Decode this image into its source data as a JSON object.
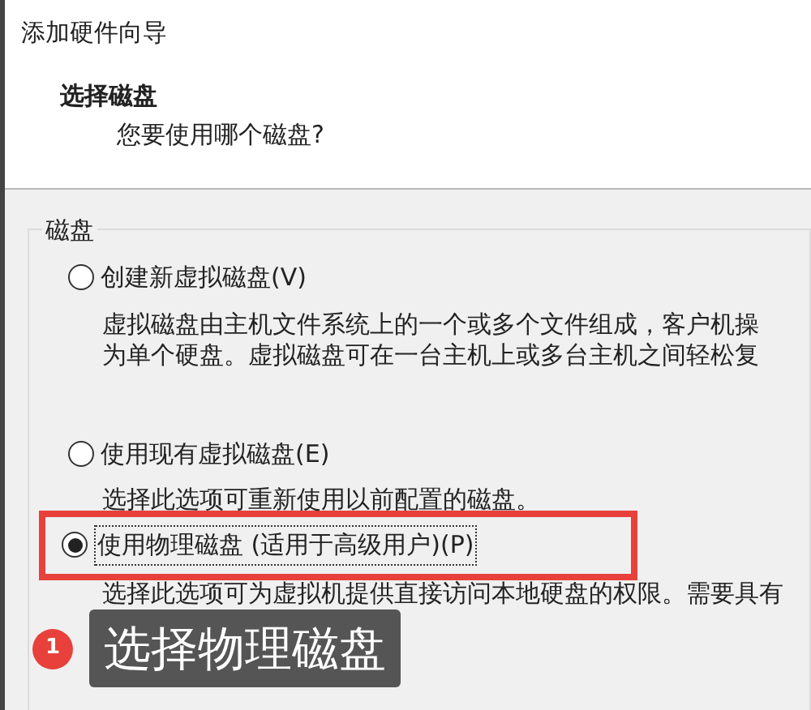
{
  "window": {
    "title": "添加硬件向导"
  },
  "header": {
    "title": "选择磁盘",
    "subtitle": "您要使用哪个磁盘?"
  },
  "group": {
    "label": "磁盘",
    "options": [
      {
        "label": "创建新虚拟磁盘(V)",
        "selected": false,
        "highlighted": false,
        "description": [
          "虚拟磁盘由主机文件系统上的一个或多个文件组成，客户机操",
          "为单个硬盘。虚拟磁盘可在一台主机上或多台主机之间轻松复"
        ]
      },
      {
        "label": "使用现有虚拟磁盘(E)",
        "selected": false,
        "highlighted": false,
        "description": [
          "选择此选项可重新使用以前配置的磁盘。"
        ]
      },
      {
        "label": "使用物理磁盘 (适用于高级用户)(P)",
        "selected": true,
        "highlighted": true,
        "description": [
          "选择此选项可为虚拟机提供直接访问本地硬盘的权限。需要具有"
        ]
      }
    ]
  },
  "annotation": {
    "number": "1",
    "text": "选择物理磁盘"
  }
}
